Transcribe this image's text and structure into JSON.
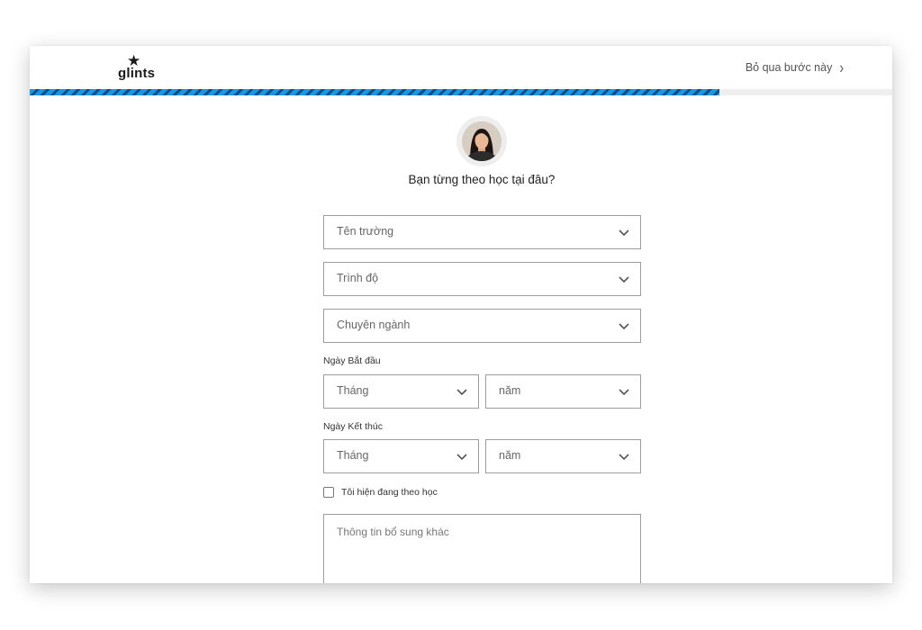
{
  "header": {
    "logo_text": "glints",
    "skip_label": "Bỏ qua bước này"
  },
  "progress": {
    "fraction": 0.8
  },
  "colors": {
    "progress_primary": "#1a96e8",
    "progress_secondary": "#114e7c",
    "field_border": "#9c9c9c"
  },
  "icons": {
    "logo": "star-icon",
    "skip": "chevron-right-icon",
    "dropdown": "chevron-down-icon"
  },
  "form": {
    "question": "Bạn từng theo học tại đâu?",
    "school_placeholder": "Tên trường",
    "level_placeholder": "Trình độ",
    "major_placeholder": "Chuyên ngành",
    "start_date_label": "Ngày Bắt đầu",
    "start_month_placeholder": "Tháng",
    "start_year_placeholder": "năm",
    "end_date_label": "Ngày Kết thúc",
    "end_month_placeholder": "Tháng",
    "end_year_placeholder": "năm",
    "currently_studying_label": "Tôi hiện đang theo học",
    "currently_studying_checked": false,
    "notes_placeholder": "Thông tin bổ sung khác"
  }
}
